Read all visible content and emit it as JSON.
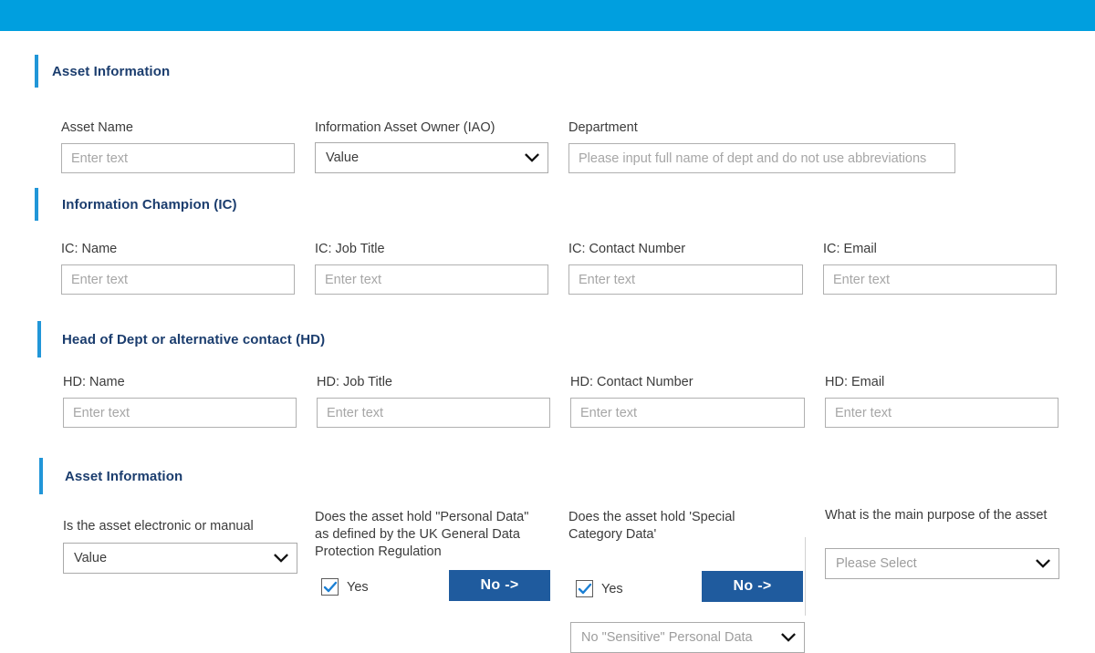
{
  "page": {
    "top_bar_color": "#009fdf",
    "accent_color": "#2196d8",
    "heading_color": "#1b3d6e",
    "button_color": "#1f5b9e"
  },
  "sections": [
    {
      "title": "Asset Information"
    },
    {
      "title": "Information Champion (IC)"
    },
    {
      "title": "Head of Dept or alternative contact (HD)"
    },
    {
      "title": "Asset Information"
    }
  ],
  "asset_info": {
    "asset_name": {
      "label": "Asset Name",
      "placeholder": "Enter text",
      "value": ""
    },
    "iao": {
      "label": "Information Asset Owner (IAO)",
      "value": "Value"
    },
    "department": {
      "label": "Department",
      "placeholder": "Please input full name of dept and do not use abbreviations",
      "value": ""
    }
  },
  "information_champion": {
    "name": {
      "label": "IC: Name",
      "placeholder": "Enter text",
      "value": ""
    },
    "job_title": {
      "label": "IC: Job Title",
      "placeholder": "Enter text",
      "value": ""
    },
    "contact_number": {
      "label": "IC: Contact Number",
      "placeholder": "Enter text",
      "value": ""
    },
    "email": {
      "label": "IC: Email",
      "placeholder": "Enter text",
      "value": ""
    }
  },
  "head_of_dept": {
    "name": {
      "label": "HD: Name",
      "placeholder": "Enter text",
      "value": ""
    },
    "job_title": {
      "label": "HD: Job Title",
      "placeholder": "Enter text",
      "value": ""
    },
    "contact_number": {
      "label": "HD: Contact Number",
      "placeholder": "Enter text",
      "value": ""
    },
    "email": {
      "label": "HD: Email",
      "placeholder": "Enter text",
      "value": ""
    }
  },
  "asset_details": {
    "electronic_or_manual": {
      "label": "Is the asset electronic or manual",
      "value": "Value"
    },
    "personal_data": {
      "label": "Does the asset hold \"Personal Data\" as defined by the UK General Data Protection Regulation",
      "checkbox_label": "Yes",
      "checked": true,
      "button_label": "No ->"
    },
    "special_category_data": {
      "label": "Does the asset hold 'Special Category Data'",
      "checkbox_label": "Yes",
      "checked": true,
      "button_label": "No ->",
      "dropdown_value": "No \"Sensitive\" Personal Data"
    },
    "main_purpose": {
      "label": "What is the main purpose of the asset",
      "dropdown_value": "Please Select"
    }
  },
  "icons": {
    "chevron_down": "chevron-down-icon",
    "checkmark": "checkmark-icon"
  }
}
